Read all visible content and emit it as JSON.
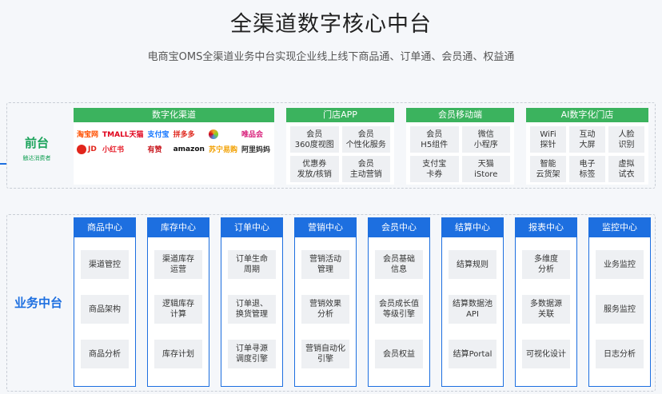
{
  "title": "全渠道数字核心中台",
  "subtitle": "电商宝OMS全渠道业务中台实现企业线上线下商品通、订单通、会员通、权益通",
  "front": {
    "label": "前台",
    "sublabel": "触达消费者",
    "panels": {
      "channels": {
        "header": "数字化渠道",
        "logos": [
          "淘宝网",
          "TMALL天猫",
          "支付宝",
          "拼多多",
          "",
          "唯品会",
          "JD",
          "小红书",
          "有赞",
          "amazon",
          "苏宁易购",
          "阿里妈妈"
        ]
      },
      "store": {
        "header": "门店APP",
        "cells": [
          "会员\n360度视图",
          "会员\n个性化服务",
          "优惠券\n发放/核销",
          "会员\n主动营销"
        ]
      },
      "member": {
        "header": "会员移动端",
        "cells": [
          "会员\nH5组件",
          "微信\n小程序",
          "支付宝\n卡券",
          "天猫\niStore"
        ]
      },
      "ai": {
        "header": "AI数字化门店",
        "cells": [
          "WiFi\n探针",
          "互动\n大屏",
          "人脸\n识别",
          "智能\n云货架",
          "电子\n标签",
          "虚拟\n试衣"
        ]
      }
    }
  },
  "biz": {
    "label": "业务中台",
    "columns": [
      {
        "header": "商品中心",
        "items": [
          "渠道管控",
          "商品架构",
          "商品分析"
        ]
      },
      {
        "header": "库存中心",
        "items": [
          "渠道库存\n运营",
          "逻辑库存\n计算",
          "库存计划"
        ]
      },
      {
        "header": "订单中心",
        "items": [
          "订单生命\n周期",
          "订单退、\n换货管理",
          "订单寻源\n调度引擎"
        ]
      },
      {
        "header": "营销中心",
        "items": [
          "营销活动\n管理",
          "营销效果\n分析",
          "营销自动化\n引擎"
        ]
      },
      {
        "header": "会员中心",
        "items": [
          "会员基础\n信息",
          "会员成长值\n等级引擎",
          "会员权益"
        ]
      },
      {
        "header": "结算中心",
        "items": [
          "结算规则",
          "结算数据池\nAPI",
          "结算Portal"
        ]
      },
      {
        "header": "报表中心",
        "items": [
          "多维度\n分析",
          "多数据源\n关联",
          "可视化设计"
        ]
      },
      {
        "header": "监控中心",
        "items": [
          "业务监控",
          "服务监控",
          "日志分析"
        ]
      }
    ]
  },
  "colors": {
    "green": "#3bb35e",
    "blue": "#1d6fe0",
    "cell": "#eef0f3"
  }
}
